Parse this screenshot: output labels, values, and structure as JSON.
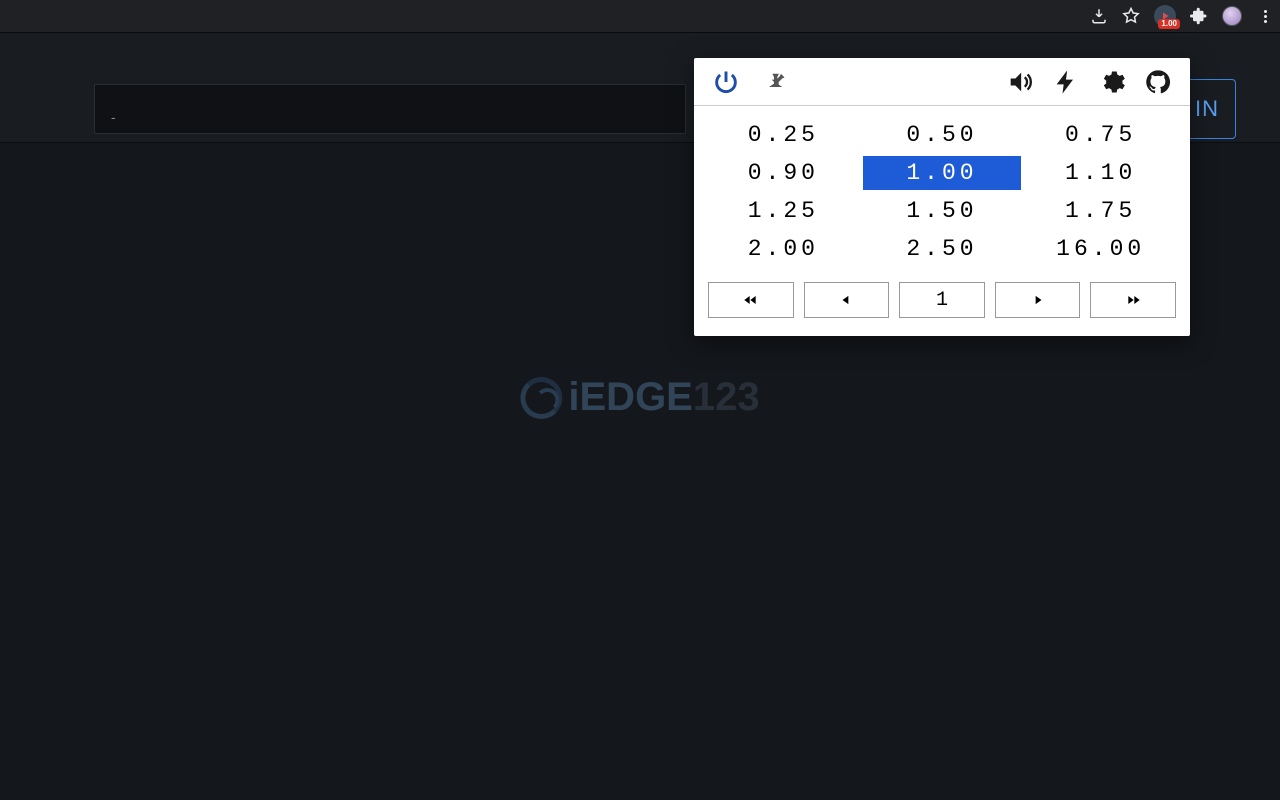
{
  "chrome": {
    "ext_badge": "1.00"
  },
  "header": {
    "search_placeholder": "-",
    "signin_label": "IN"
  },
  "watermark": {
    "brand_a": "iEDGE",
    "brand_b": "123"
  },
  "popup": {
    "speeds": [
      "0.25",
      "0.50",
      "0.75",
      "0.90",
      "1.00",
      "1.10",
      "1.25",
      "1.50",
      "1.75",
      "2.00",
      "2.50",
      "16.00"
    ],
    "selected_speed": "1.00",
    "stepper_value": "1"
  }
}
